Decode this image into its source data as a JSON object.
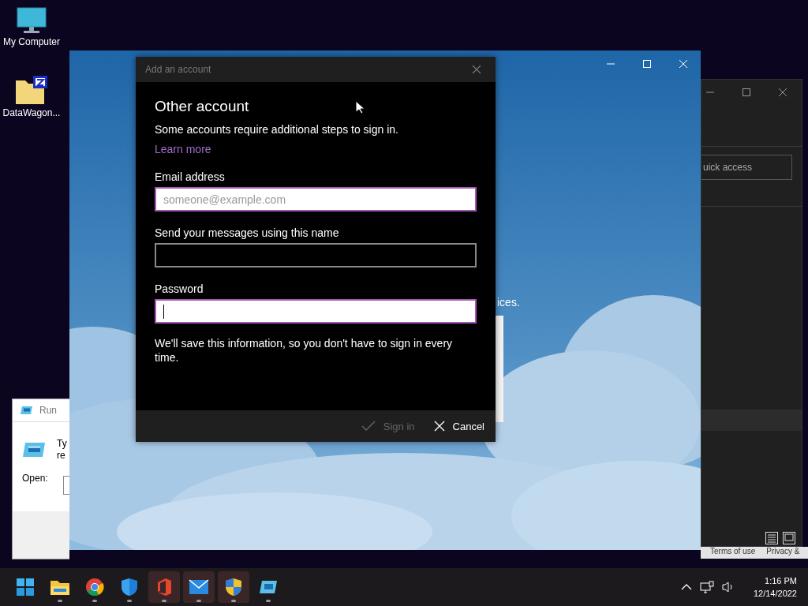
{
  "desktop_icons": [
    {
      "label": "My Computer",
      "kind": "computer"
    },
    {
      "label": "DataWagon...",
      "kind": "archive"
    }
  ],
  "explorer_window": {
    "search_placeholder": "uick access",
    "footer_links": [
      "Terms of use",
      "Privacy &"
    ]
  },
  "run_dialog": {
    "title": "Run",
    "description_lines": [
      "Ty",
      "re"
    ],
    "open_label": "Open:"
  },
  "mail_window": {
    "background_text": "ices."
  },
  "dialog": {
    "title": "Add an account",
    "heading": "Other account",
    "intro": "Some accounts require additional steps to sign in.",
    "link": "Learn more",
    "fields": [
      {
        "label": "Email address",
        "placeholder": "someone@example.com",
        "highlighted": true,
        "focused": false
      },
      {
        "label": "Send your messages using this name",
        "highlighted": false,
        "focused": false
      },
      {
        "label": "Password",
        "highlighted": true,
        "focused": true
      }
    ],
    "note": "We'll save this information, so you don't have to sign in every time.",
    "buttons": [
      {
        "label": "Sign in",
        "kind": "confirm",
        "disabled": true
      },
      {
        "label": "Cancel",
        "kind": "cancel",
        "disabled": false
      }
    ]
  },
  "taskbar": {
    "apps": [
      {
        "kind": "start",
        "highlighted": false
      },
      {
        "kind": "folder",
        "highlighted": false
      },
      {
        "kind": "browser",
        "highlighted": false
      },
      {
        "kind": "defender",
        "highlighted": false
      },
      {
        "kind": "office",
        "highlighted": true
      },
      {
        "kind": "mail",
        "highlighted": true
      },
      {
        "kind": "shield",
        "highlighted": true
      },
      {
        "kind": "run",
        "highlighted": false
      }
    ],
    "time": "1:16 PM",
    "date": "12/14/2022"
  }
}
